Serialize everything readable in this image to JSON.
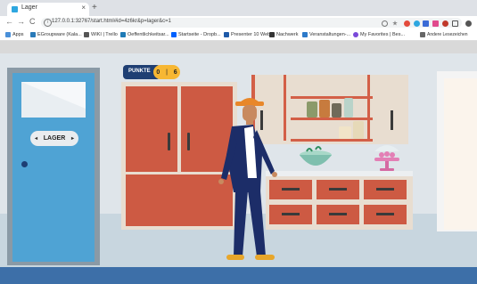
{
  "browser": {
    "tab_title": "Lager",
    "tab_close": "×",
    "new_tab": "+",
    "url": "127.0.0.1:32767/start.html#id=4z6kr&p=lager&c=1",
    "back": "←",
    "forward": "→",
    "reload": "C",
    "info": "i"
  },
  "bookmarks": [
    {
      "label": "Apps",
      "color": "#4a90d9"
    },
    {
      "label": "EGroupware (Kala...",
      "color": "#2a7ab8"
    },
    {
      "label": "WIKI | Trello",
      "color": "#555555"
    },
    {
      "label": "Oeffentlichkeitsar...",
      "color": "#1f7bb6"
    },
    {
      "label": "Startseite - Dropb...",
      "color": "#0061fe"
    },
    {
      "label": "Presenter 10 Web",
      "color": "#1e5aa8"
    },
    {
      "label": "Nachwerk",
      "color": "#333333"
    },
    {
      "label": "Veranstaltungen-...",
      "color": "#2d7ac9"
    },
    {
      "label": "My Favorites | Bes...",
      "color": "#7a4ad9"
    },
    {
      "label": "Andere Lesezeichen",
      "color": "#666666"
    }
  ],
  "game": {
    "door_sign": "LAGER",
    "score_label": "PUNKTE",
    "score_value": "0",
    "score_total": "6"
  },
  "colors": {
    "cabinet": "#cd5a43",
    "door": "#4fa3d4",
    "score_badge": "#1f3f73",
    "score_pill": "#f7b733",
    "floor_stripe": "#3d6fa8"
  }
}
